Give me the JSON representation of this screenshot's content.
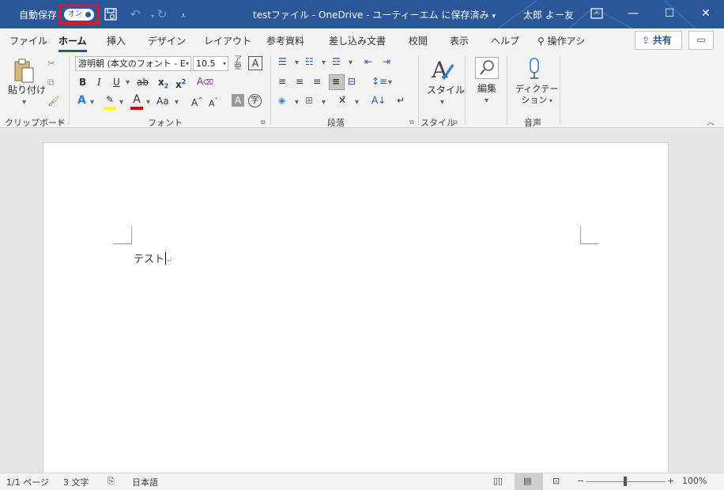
{
  "titlebar": {
    "autosave_label": "自動保存",
    "autosave_toggle": "オン",
    "document_title": "testファイル - OneDrive - ユーティーエム に保存済み",
    "title_caret": "▾",
    "user_name": "太郎 よー友",
    "icons": [
      "save-icon",
      "undo-icon",
      "redo-icon",
      "customize-qat-icon"
    ]
  },
  "tabs": [
    "ファイル",
    "ホーム",
    "挿入",
    "デザイン",
    "レイアウト",
    "参考資料",
    "差し込み文書",
    "校閲",
    "表示",
    "ヘルプ",
    "操作アシ"
  ],
  "share_label": "共有",
  "ribbon": {
    "clipboard": {
      "paste_label": "貼り付け",
      "group_label": "クリップボード"
    },
    "font": {
      "font_name": "游明朝 (本文のフォント - E",
      "font_size": "10.5",
      "bold": "B",
      "italic": "I",
      "underline": "U",
      "strike": "ab",
      "subscript": "x",
      "subscript_sub": "2",
      "superscript": "x",
      "superscript_sup": "2",
      "text_effect": "A",
      "font_color": "A",
      "change_case": "Aa",
      "grow": "A",
      "shrink": "A",
      "char_shading": "A",
      "highlight_color": "#ffff00",
      "font_color_bar": "#e00000",
      "group_label": "フォント"
    },
    "paragraph": {
      "group_label": "段落"
    },
    "styles": {
      "button_label": "スタイル",
      "group_label": "スタイル"
    },
    "editing": {
      "button_label": "編集"
    },
    "voice": {
      "button_label_1": "ディクテー",
      "button_label_2": "ション",
      "group_label": "音声"
    }
  },
  "document": {
    "text": "テスト",
    "pilcrow": "↵"
  },
  "statusbar": {
    "page": "1/1 ページ",
    "words": "3 文字",
    "language": "日本語",
    "zoom_minus": "−",
    "zoom_plus": "+",
    "zoom": "100%"
  },
  "colors": {
    "title_bar": "#2b579a",
    "highlight_border": "#e5141d"
  }
}
